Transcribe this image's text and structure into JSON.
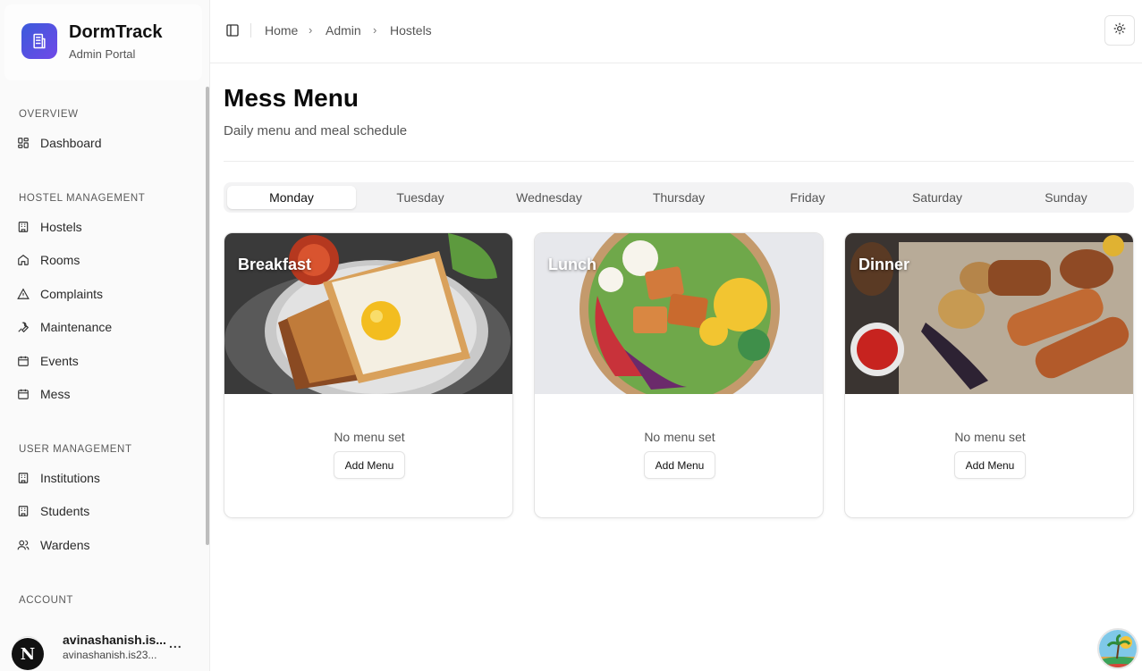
{
  "brand": {
    "title": "DormTrack",
    "subtitle": "Admin Portal"
  },
  "sidebar": {
    "sections": [
      {
        "label": "OVERVIEW",
        "items": [
          {
            "label": "Dashboard",
            "icon": "grid-icon"
          }
        ]
      },
      {
        "label": "HOSTEL MANAGEMENT",
        "items": [
          {
            "label": "Hostels",
            "icon": "building-icon"
          },
          {
            "label": "Rooms",
            "icon": "home-icon"
          },
          {
            "label": "Complaints",
            "icon": "alert-triangle-icon"
          },
          {
            "label": "Maintenance",
            "icon": "wrench-icon"
          },
          {
            "label": "Events",
            "icon": "calendar-icon"
          },
          {
            "label": "Mess",
            "icon": "calendar-icon"
          }
        ]
      },
      {
        "label": "USER MANAGEMENT",
        "items": [
          {
            "label": "Institutions",
            "icon": "building-icon"
          },
          {
            "label": "Students",
            "icon": "building-icon"
          },
          {
            "label": "Wardens",
            "icon": "users-icon"
          }
        ]
      },
      {
        "label": "ACCOUNT",
        "items": []
      }
    ],
    "account": {
      "name": "avinashanish.is...",
      "email": "avinashanish.is23...",
      "more": "..."
    }
  },
  "header": {
    "breadcrumb": [
      "Home",
      "Admin",
      "Hostels"
    ],
    "separator": "›"
  },
  "main": {
    "title": "Mess Menu",
    "subtitle": "Daily menu and meal schedule",
    "tabs": [
      "Monday",
      "Tuesday",
      "Wednesday",
      "Thursday",
      "Friday",
      "Saturday",
      "Sunday"
    ],
    "active_tab": "Monday",
    "meals": [
      {
        "title": "Breakfast",
        "empty_text": "No menu set",
        "button": "Add Menu"
      },
      {
        "title": "Lunch",
        "empty_text": "No menu set",
        "button": "Add Menu"
      },
      {
        "title": "Dinner",
        "empty_text": "No menu set",
        "button": "Add Menu"
      }
    ]
  },
  "colors": {
    "brand_gradient_start": "#3b5bdb",
    "brand_gradient_end": "#7048e8",
    "sidebar_bg": "#fafafa",
    "tab_bg": "#f3f3f4"
  }
}
